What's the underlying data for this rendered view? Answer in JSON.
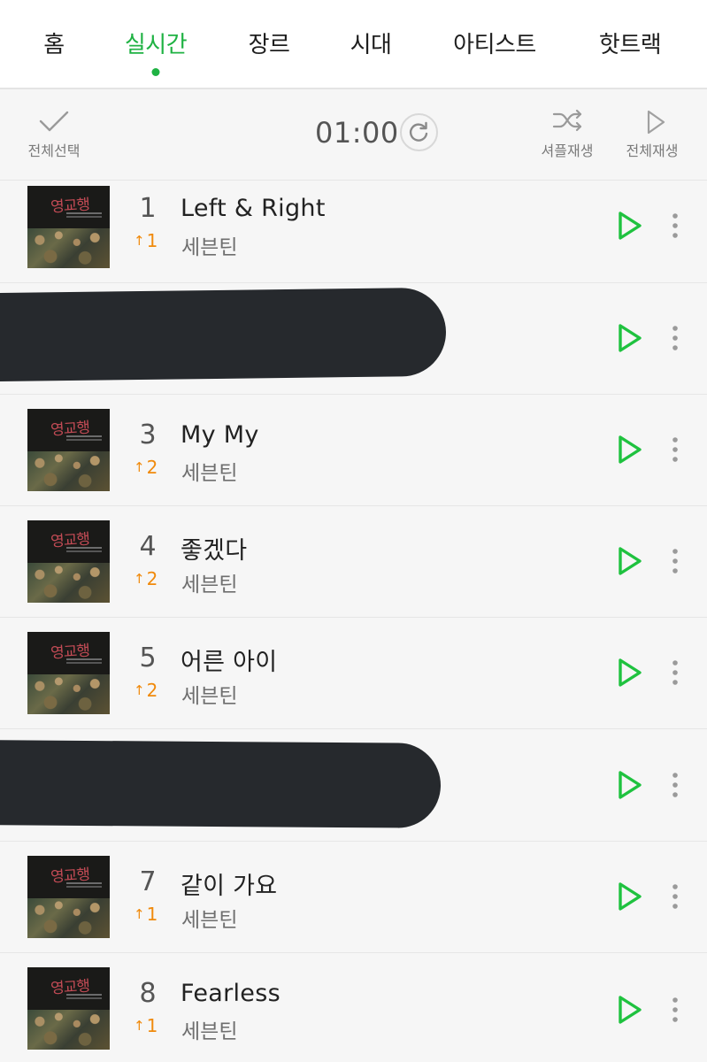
{
  "tabs": [
    {
      "label": "홈",
      "active": false
    },
    {
      "label": "실시간",
      "active": true
    },
    {
      "label": "장르",
      "active": false
    },
    {
      "label": "시대",
      "active": false
    },
    {
      "label": "아티스트",
      "active": false
    },
    {
      "label": "핫트랙",
      "active": false
    }
  ],
  "toolbar": {
    "select_all": "전체선택",
    "time": "01:00",
    "shuffle": "셔플재생",
    "play_all": "전체재생"
  },
  "colors": {
    "accent": "#1fb243",
    "rank_up": "#f08a0c",
    "redaction": "#26292d"
  },
  "album_art_text": "영교행",
  "tracks": [
    {
      "rank": "1",
      "change": "1",
      "title": "Left & Right",
      "artist": "세븐틴",
      "redacted": false
    },
    {
      "rank": "",
      "change": "",
      "title": "",
      "artist": "",
      "redacted": true
    },
    {
      "rank": "3",
      "change": "2",
      "title": "My My",
      "artist": "세븐틴",
      "redacted": false
    },
    {
      "rank": "4",
      "change": "2",
      "title": "좋겠다",
      "artist": "세븐틴",
      "redacted": false
    },
    {
      "rank": "5",
      "change": "2",
      "title": "어른 아이",
      "artist": "세븐틴",
      "redacted": false
    },
    {
      "rank": "",
      "change": "",
      "title": "",
      "artist": "",
      "redacted": true
    },
    {
      "rank": "7",
      "change": "1",
      "title": "같이 가요",
      "artist": "세븐틴",
      "redacted": false
    },
    {
      "rank": "8",
      "change": "1",
      "title": "Fearless",
      "artist": "세븐틴",
      "redacted": false
    }
  ]
}
